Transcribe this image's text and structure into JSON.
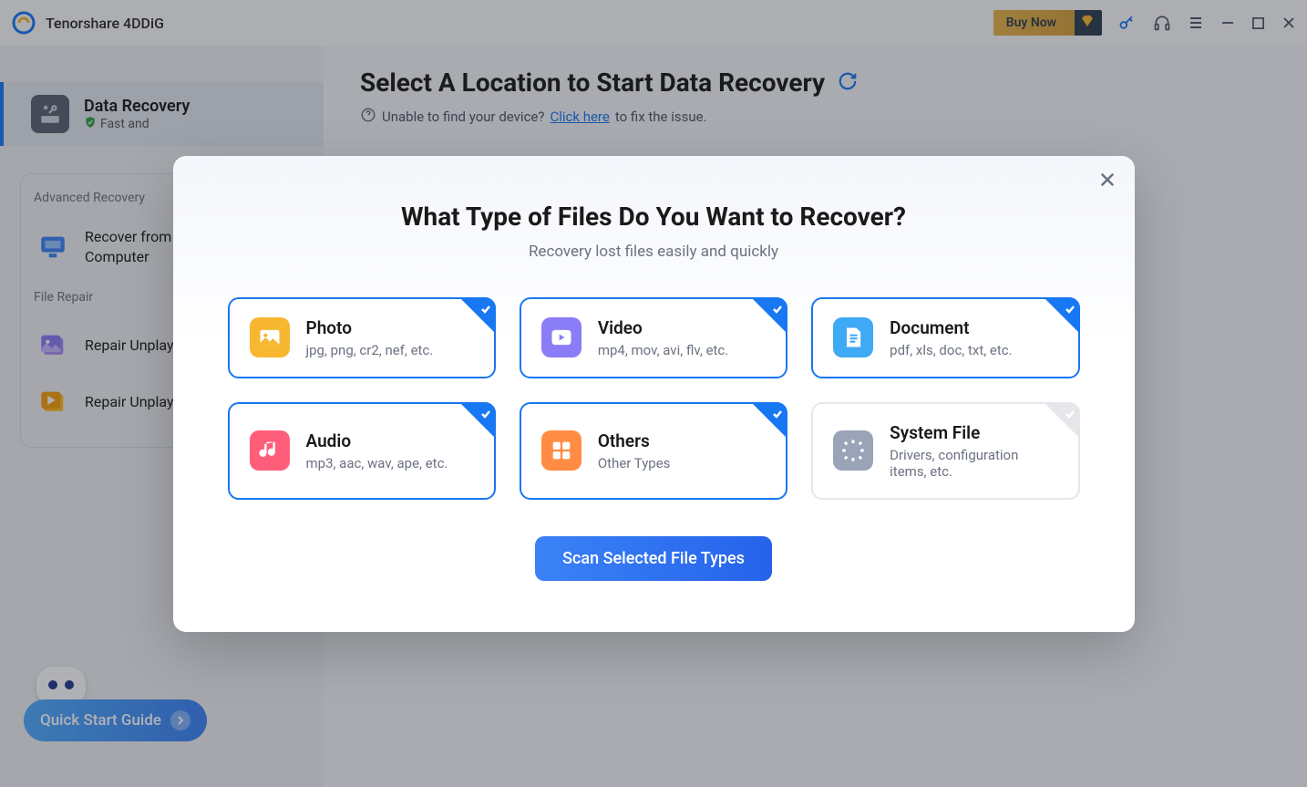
{
  "app": {
    "title": "Tenorshare 4DDiG"
  },
  "titlebar": {
    "buy_now": "Buy Now"
  },
  "sidebar": {
    "data_recovery": {
      "title": "Data Recovery",
      "sub": "Fast and"
    },
    "advanced_header": "Advanced Recovery",
    "recover_crashed": "Recover from Crashed Computer",
    "file_repair_header": "File Repair",
    "repair_photos": "Repair Unplayable Photos",
    "repair_videos": "Repair Unplayable Videos",
    "quick_start": "Quick Start Guide"
  },
  "main": {
    "title": "Select A Location to Start Data Recovery",
    "help_prefix": "Unable to find your device?",
    "help_link": "Click here",
    "help_suffix": "to fix the issue."
  },
  "modal": {
    "title": "What Type of Files Do You Want to Recover?",
    "subtitle": "Recovery lost files easily and quickly",
    "scan_button": "Scan Selected File Types",
    "types": [
      {
        "name": "Photo",
        "desc": "jpg, png, cr2, nef, etc.",
        "color": "#f7b731",
        "selected": true
      },
      {
        "name": "Video",
        "desc": "mp4, mov, avi, flv, etc.",
        "color": "#8b7cf8",
        "selected": true
      },
      {
        "name": "Document",
        "desc": "pdf, xls, doc, txt, etc.",
        "color": "#3ea9f5",
        "selected": true
      },
      {
        "name": "Audio",
        "desc": "mp3, aac, wav, ape, etc.",
        "color": "#ff5e7a",
        "selected": true
      },
      {
        "name": "Others",
        "desc": "Other Types",
        "color": "#ff8c42",
        "selected": true
      },
      {
        "name": "System File",
        "desc": "Drivers, configuration items, etc.",
        "color": "#9aa3b8",
        "selected": false
      }
    ]
  }
}
